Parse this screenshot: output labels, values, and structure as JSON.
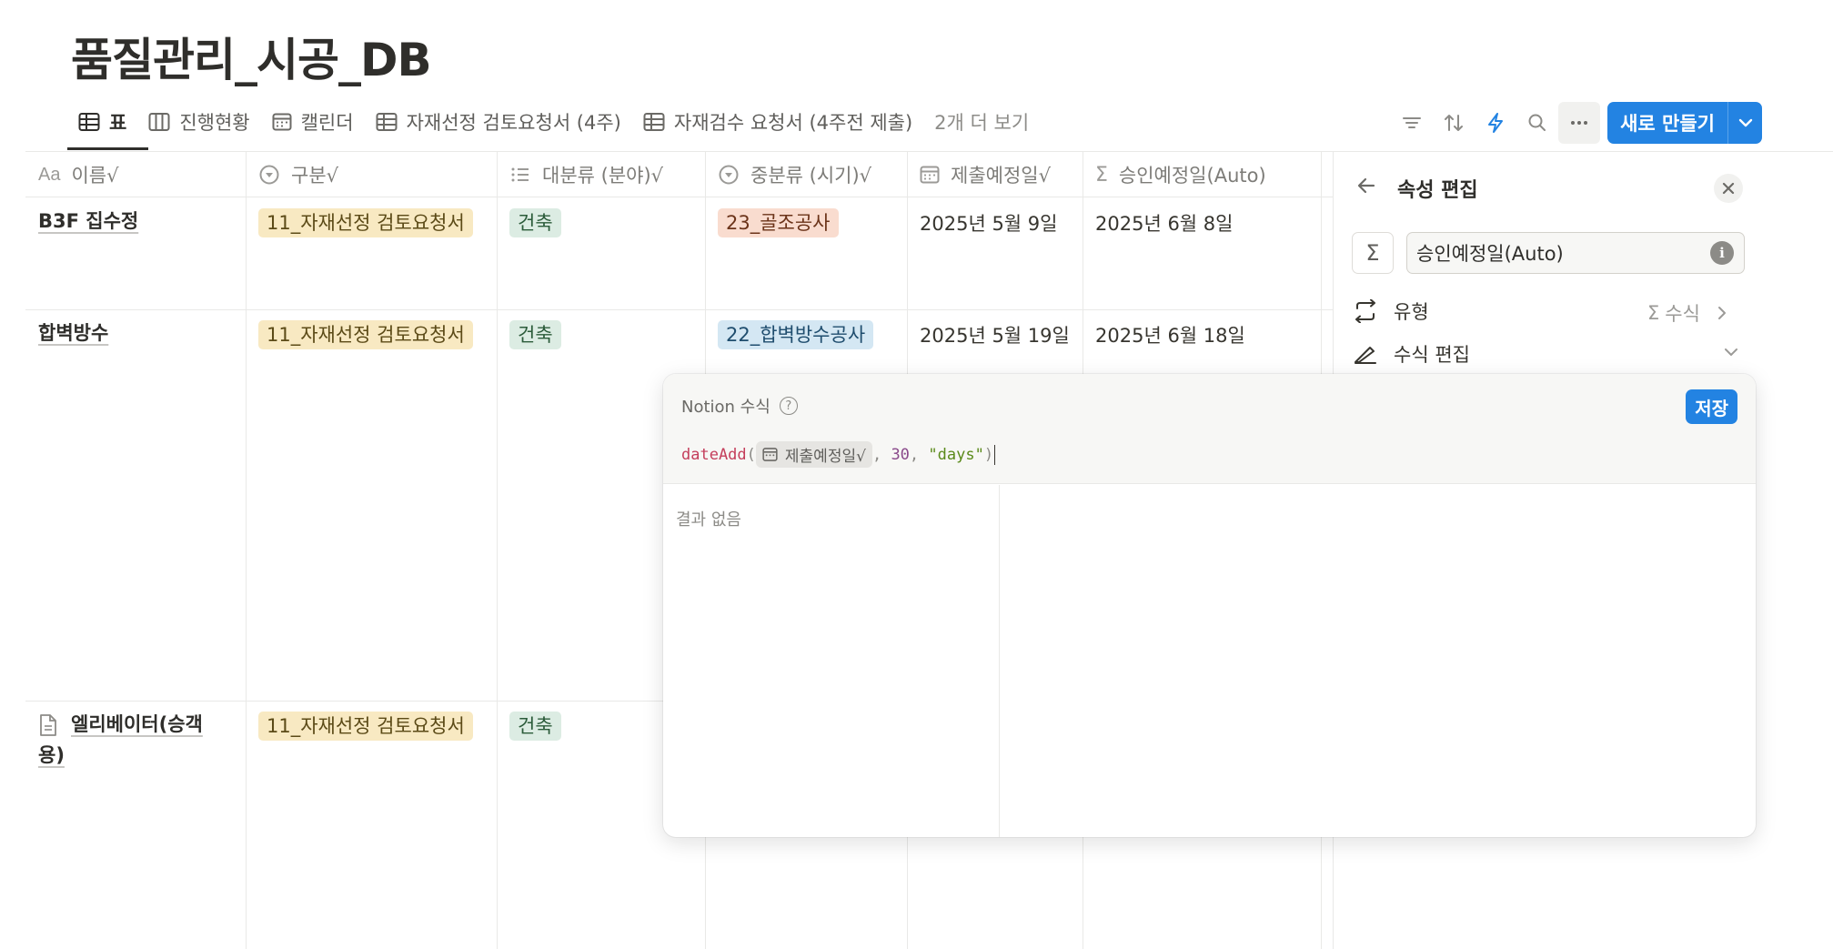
{
  "page": {
    "title": "품질관리_시공_DB"
  },
  "views": {
    "tabs": [
      {
        "label": "표",
        "icon": "table-icon"
      },
      {
        "label": "진행현황",
        "icon": "board-icon"
      },
      {
        "label": "캘린더",
        "icon": "calendar-icon"
      },
      {
        "label": "자재선정 검토요청서 (4주)",
        "icon": "table-icon"
      },
      {
        "label": "자재검수 요청서 (4주전 제출)",
        "icon": "table-icon"
      }
    ],
    "more": "2개 더 보기",
    "active_index": 0
  },
  "toolbar": {
    "icons": [
      "filter-icon",
      "sort-icon",
      "automation-icon",
      "search-icon",
      "more-icon"
    ],
    "new_label": "새로 만들기"
  },
  "table": {
    "columns": [
      {
        "label": "이름√",
        "icon": "Aa"
      },
      {
        "label": "구분√",
        "icon": "select-icon"
      },
      {
        "label": "대분류 (분야)√",
        "icon": "list-icon"
      },
      {
        "label": "중분류 (시기)√",
        "icon": "select-icon"
      },
      {
        "label": "제출예정일√",
        "icon": "calendar-icon"
      },
      {
        "label": "승인예정일(Auto)",
        "icon": "sigma-icon"
      }
    ],
    "rows": [
      {
        "name": "B3F 집수정",
        "category": "11_자재선정 검토요청서",
        "major": "건축",
        "minor": "23_골조공사",
        "submit": "2025년 5월 9일",
        "approve": "2025년 6월 8일"
      },
      {
        "name": "합벽방수",
        "category": "11_자재선정 검토요청서",
        "major": "건축",
        "minor": "22_합벽방수공사",
        "submit": "2025년 5월 19일",
        "approve": "2025년 6월 18일"
      },
      {
        "name": "엘리베이터(승객용)",
        "category": "11_자재선정 검토요청서",
        "major": "건축",
        "minor": "",
        "submit": "",
        "approve": ""
      }
    ]
  },
  "side_panel": {
    "title": "속성 편집",
    "property_name": "승인예정일(Auto)",
    "type_label": "유형",
    "type_value": "수식",
    "edit_label": "수식 편집"
  },
  "formula": {
    "title": "Notion 수식",
    "save_label": "저장",
    "fn": "dateAdd",
    "open_paren": "(",
    "prop": "제출예정일√",
    "sep1": ", ",
    "num": "30",
    "sep2": ", ",
    "str": "\"days\"",
    "close_paren": ")",
    "result_empty": "결과 없음"
  },
  "colors": {
    "accent": "#2383e2",
    "tag_yellow": "#f8e9c2",
    "tag_green": "#dcece3",
    "tag_orange": "#f9dccf",
    "tag_blue": "#d4e7f3"
  }
}
